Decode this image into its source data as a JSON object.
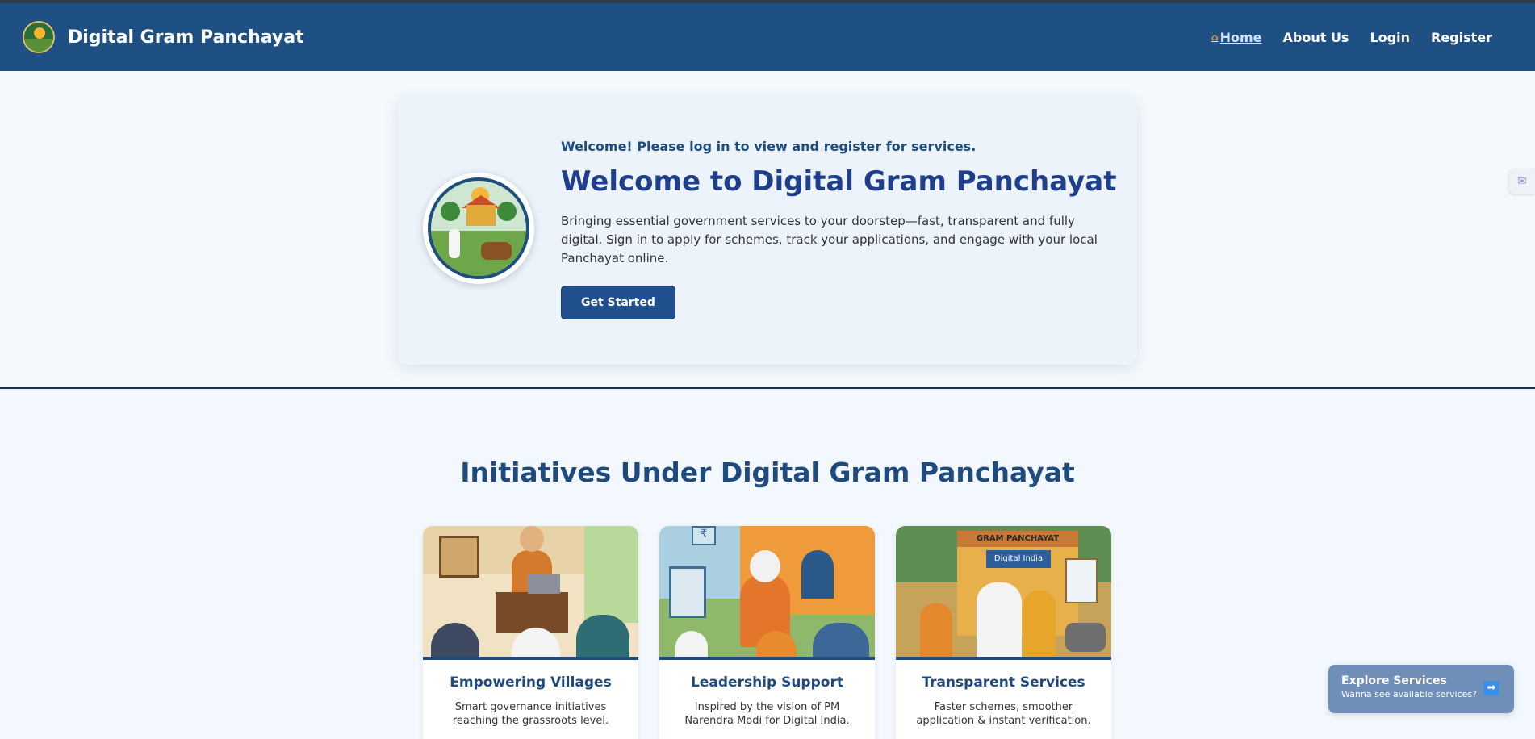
{
  "brand": {
    "title": "Digital Gram Panchayat",
    "logo_icon": "village-emblem-icon"
  },
  "nav": [
    {
      "label": "Home",
      "icon": "home-icon",
      "active": true
    },
    {
      "label": "About Us"
    },
    {
      "label": "Login"
    },
    {
      "label": "Register"
    }
  ],
  "hero": {
    "notice": "Welcome! Please log in to view and register for services.",
    "title": "Welcome to Digital Gram Panchayat",
    "description": "Bringing essential government services to your doorstep—fast, transparent and fully digital. Sign in to apply for schemes, track your applications, and engage with your local Panchayat online.",
    "cta_label": "Get Started"
  },
  "initiatives": {
    "title": "Initiatives Under Digital Gram Panchayat",
    "cards": [
      {
        "title": "Empowering Villages",
        "desc": "Smart governance initiatives reaching the grassroots level."
      },
      {
        "title": "Leadership Support",
        "desc": "Inspired by the vision of PM Narendra Modi for Digital India."
      },
      {
        "title": "Transparent Services",
        "desc": "Faster schemes, smoother application & instant verification."
      }
    ]
  },
  "illustration_text": {
    "card3_sign": "GRAM PANCHAYAT",
    "card3_banner": "Digital India",
    "card2_rupee": "₹"
  },
  "explore": {
    "title": "Explore Services",
    "subtitle": "Wanna see available services?",
    "icon": "arrow-right-icon"
  },
  "colors": {
    "navbar": "#1e5083",
    "accent": "#1f4f8d",
    "heading": "#1e4a7e"
  }
}
